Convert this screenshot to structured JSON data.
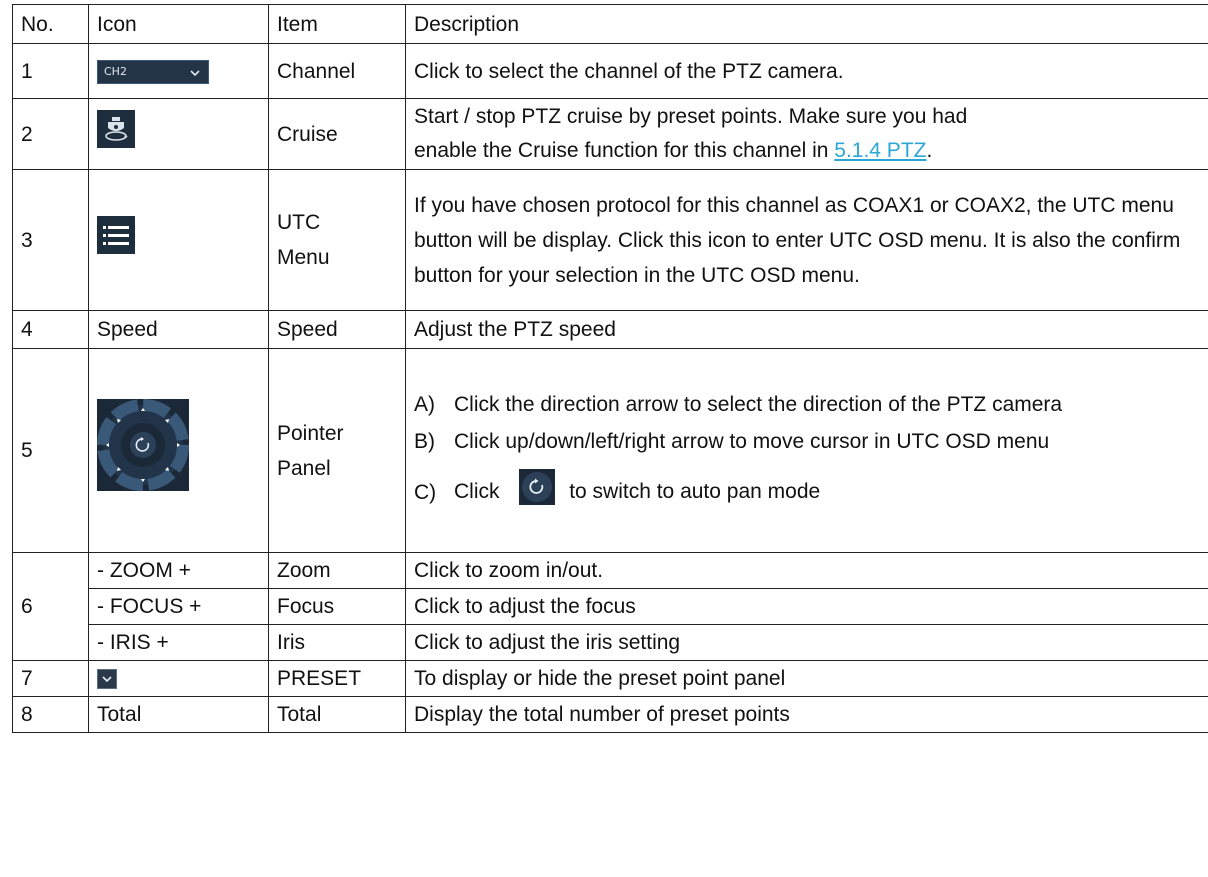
{
  "headers": {
    "no": "No.",
    "icon": "Icon",
    "item": "Item",
    "description": "Description"
  },
  "rows": {
    "r1": {
      "no": "1",
      "icon_text": "CH2",
      "icon_name": "channel-select-dropdown",
      "item": "Channel",
      "description": "Click to select the channel of the PTZ camera."
    },
    "r2": {
      "no": "2",
      "icon_name": "cruise-camera-icon",
      "item": "Cruise",
      "desc_line1": "Start / stop PTZ cruise by preset points. Make sure you had",
      "desc_line2": "enable the Cruise function for this channel in ",
      "desc_link": "5.1.4 PTZ",
      "desc_end": "."
    },
    "r3": {
      "no": "3",
      "icon_name": "menu-list-icon",
      "item_line1": "UTC",
      "item_line2": "Menu",
      "description": "If you have chosen protocol for this channel as COAX1 or COAX2, the UTC menu button will be display. Click this icon to enter UTC OSD menu. It is also the confirm button for your selection in the UTC OSD menu."
    },
    "r4": {
      "no": "4",
      "icon": "Speed",
      "item": "Speed",
      "description": "Adjust the PTZ speed"
    },
    "r5": {
      "no": "5",
      "icon_name": "pointer-panel-icon",
      "item_line1": "Pointer",
      "item_line2": "Panel",
      "a_label": "A)",
      "a_text": "Click the direction arrow to select the direction of the PTZ camera",
      "b_label": "B)",
      "b_text": "Click up/down/left/right arrow to move cursor in UTC OSD menu",
      "c_label": "C)",
      "c_text_before": "Click",
      "c_text_after": "to switch to auto pan mode"
    },
    "r6": {
      "no": "6",
      "zoom": {
        "icon": "- ZOOM +",
        "item": "Zoom",
        "description": "Click to zoom in/out."
      },
      "focus": {
        "icon": "- FOCUS +",
        "item": "Focus",
        "description": "Click to adjust the focus"
      },
      "iris": {
        "icon": "- IRIS +",
        "item": "Iris",
        "description": "Click to adjust the iris setting"
      }
    },
    "r7": {
      "no": "7",
      "icon_name": "chevron-down-icon",
      "item": "PRESET",
      "description": "To display or hide the preset point panel"
    },
    "r8": {
      "no": "8",
      "icon": "Total",
      "item": "Total",
      "description": "Display the total number of preset points"
    }
  },
  "colors": {
    "link": "#2aa7d6",
    "icon_bg": "#233447",
    "border": "#222222"
  }
}
